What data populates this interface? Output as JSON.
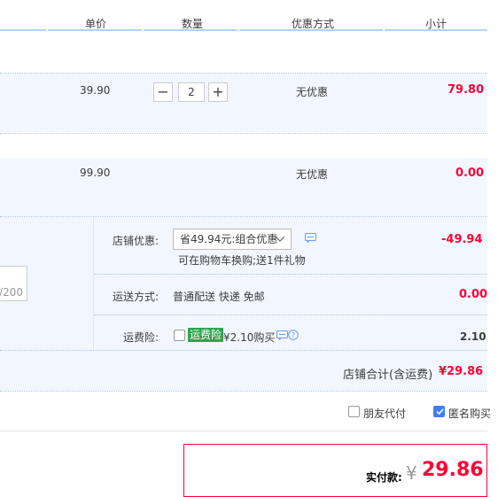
{
  "header": {
    "unit_price": "单价",
    "quantity": "数量",
    "discount": "优惠方式",
    "subtotal": "小计"
  },
  "items": [
    {
      "price": "39.90",
      "quantity": "2",
      "discount": "无优惠",
      "subtotal": "79.80"
    },
    {
      "price": "99.90",
      "discount": "无优惠",
      "subtotal": "0.00"
    }
  ],
  "shop": {
    "discount_label": "店铺优惠:",
    "discount_select": "省49.94元:组合优惠",
    "discount_note": "可在购物车换购;送1件礼物",
    "discount_amount": "-49.94",
    "shipping_label": "运送方式:",
    "shipping_value": "普通配送 快递 免邮",
    "shipping_amount": "0.00",
    "insurance_label": "运费险:",
    "insurance_tag": "运费险",
    "insurance_value": "¥2.10购买",
    "insurance_amount": "2.10",
    "note_placeholder": "/200",
    "total_label": "店铺合计(含运费)",
    "total_amount": "¥29.86"
  },
  "options": {
    "friend_pay": "朋友代付",
    "anonymous": "匿名购买"
  },
  "payment": {
    "label": "实付款:",
    "currency": "¥",
    "amount": "29.86"
  },
  "icons": {
    "message": "chat-bubble-icon",
    "help": "question-circle-icon",
    "check": "check-icon",
    "chevron": "chevron-down-icon"
  },
  "colors": {
    "accent_red": "#ff0036",
    "row_band": "#f2f7ff",
    "checkbox_blue": "#3d7ef9",
    "insurance_green": "#2ea44f"
  }
}
